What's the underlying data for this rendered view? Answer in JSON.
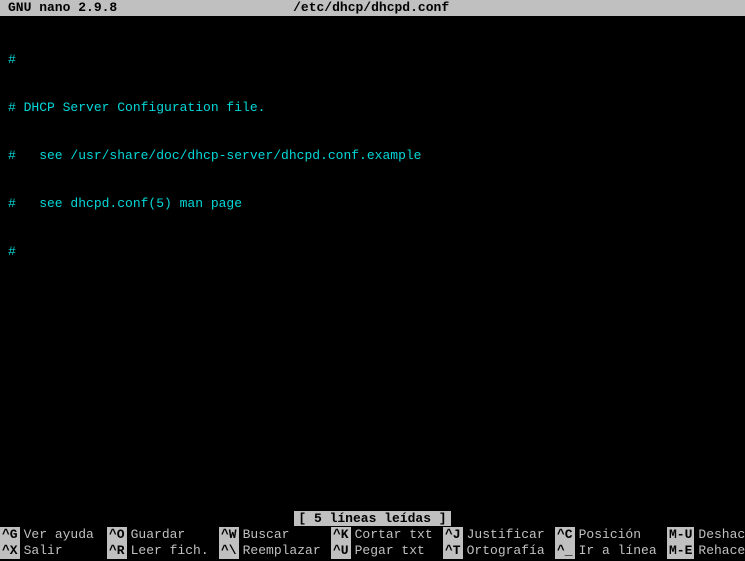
{
  "titlebar": {
    "app": "GNU nano 2.9.8",
    "filename": "/etc/dhcp/dhcpd.conf"
  },
  "editor": {
    "lines": [
      "#",
      "# DHCP Server Configuration file.",
      "#   see /usr/share/doc/dhcp-server/dhcpd.conf.example",
      "#   see dhcpd.conf(5) man page",
      "#"
    ]
  },
  "status": {
    "message": "[ 5 líneas leídas ]"
  },
  "help": {
    "row1": [
      {
        "key": "^G",
        "label": "Ver ayuda"
      },
      {
        "key": "^O",
        "label": "Guardar"
      },
      {
        "key": "^W",
        "label": "Buscar"
      },
      {
        "key": "^K",
        "label": "Cortar txt"
      },
      {
        "key": "^J",
        "label": "Justificar"
      },
      {
        "key": "^C",
        "label": "Posición"
      },
      {
        "key": "M-U",
        "label": "Deshacer"
      }
    ],
    "row2": [
      {
        "key": "^X",
        "label": "Salir"
      },
      {
        "key": "^R",
        "label": "Leer fich."
      },
      {
        "key": "^\\",
        "label": "Reemplazar"
      },
      {
        "key": "^U",
        "label": "Pegar txt"
      },
      {
        "key": "^T",
        "label": "Ortografía"
      },
      {
        "key": "^_",
        "label": "Ir a línea"
      },
      {
        "key": "M-E",
        "label": "Rehacer"
      }
    ]
  }
}
